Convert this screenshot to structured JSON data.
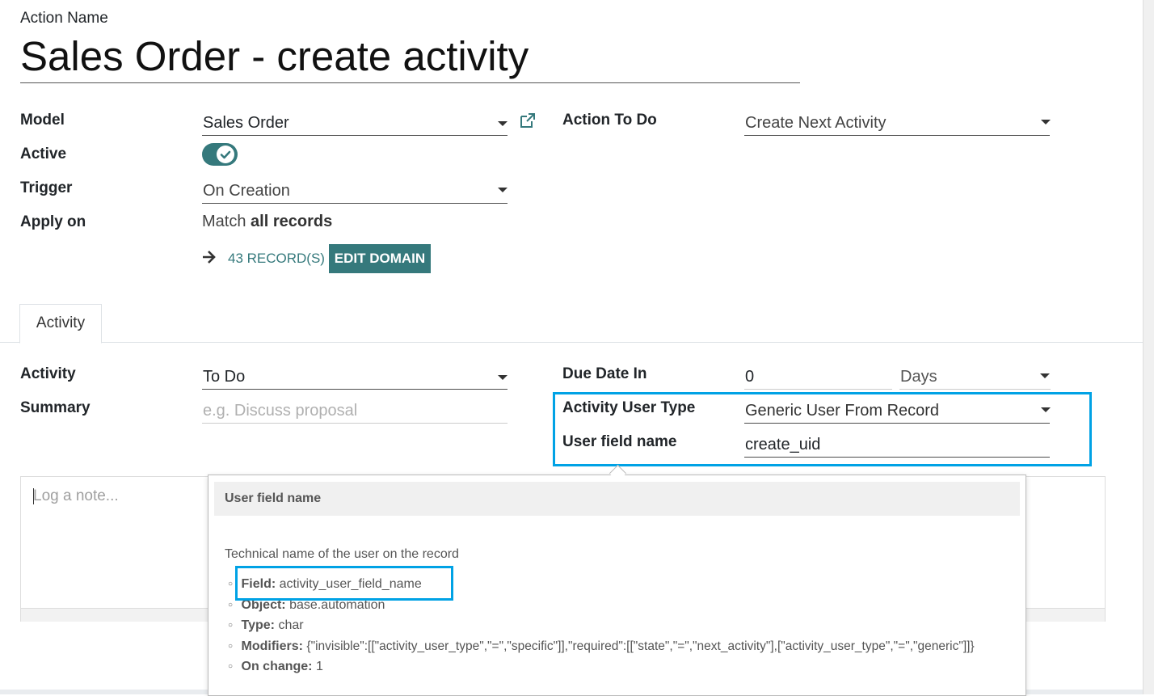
{
  "header": {
    "action_name_label": "Action Name",
    "action_name_value": "Sales Order - create activity"
  },
  "form": {
    "model_label": "Model",
    "model_value": "Sales Order",
    "active_label": "Active",
    "trigger_label": "Trigger",
    "trigger_value": "On Creation",
    "apply_on_label": "Apply on",
    "apply_on_prefix": "Match",
    "apply_on_bold": "all records",
    "records_link": "43 RECORD(S)",
    "edit_domain_button": "EDIT DOMAIN",
    "action_to_do_label": "Action To Do",
    "action_to_do_value": "Create Next Activity"
  },
  "tabs": [
    {
      "label": "Activity"
    }
  ],
  "activity": {
    "activity_label": "Activity",
    "activity_value": "To Do",
    "summary_label": "Summary",
    "summary_placeholder": "e.g. Discuss proposal",
    "due_date_label": "Due Date In",
    "due_date_value": "0",
    "due_unit_value": "Days",
    "user_type_label": "Activity User Type",
    "user_type_value": "Generic User From Record",
    "user_field_label": "User field name",
    "user_field_value": "create_uid",
    "note_placeholder": "Log a note..."
  },
  "tooltip": {
    "title": "User field name",
    "description": "Technical name of the user on the record",
    "items": [
      {
        "key": "Field:",
        "value": "activity_user_field_name"
      },
      {
        "key": "Object:",
        "value": "base.automation"
      },
      {
        "key": "Type:",
        "value": "char"
      },
      {
        "key": "Modifiers:",
        "value": "{\"invisible\":[[\"activity_user_type\",\"=\",\"specific\"]],\"required\":[[\"state\",\"=\",\"next_activity\"],[\"activity_user_type\",\"=\",\"generic\"]]}"
      },
      {
        "key": "On change:",
        "value": "1"
      }
    ]
  },
  "colors": {
    "accent": "#35797c",
    "highlight": "#00a2e5"
  },
  "icons": {
    "external_link": "external-link-icon",
    "arrow_right": "arrow-right-icon",
    "check": "check-icon",
    "caret": "caret-down-icon"
  }
}
